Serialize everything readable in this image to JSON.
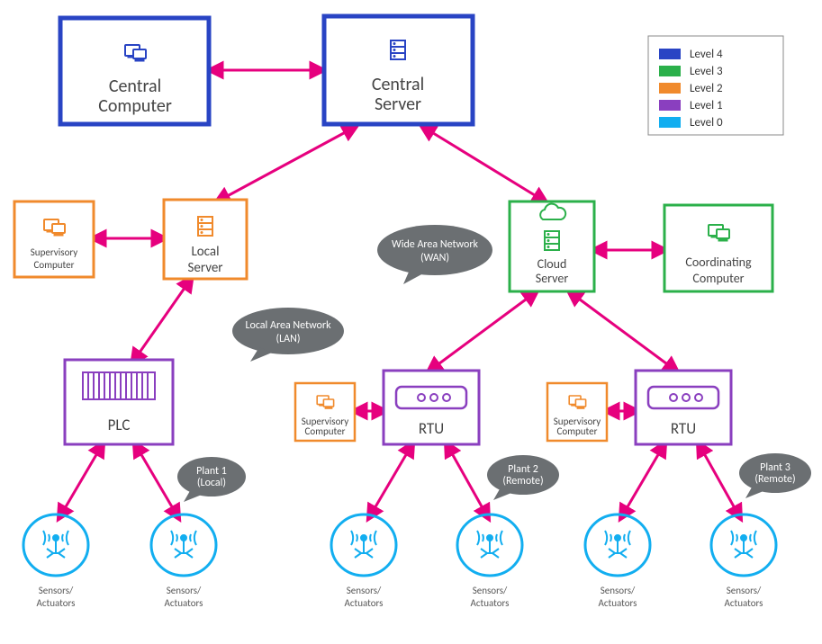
{
  "colors": {
    "level4": "#2944c4",
    "level3": "#2bb04a",
    "level2": "#f08a2c",
    "level1": "#8a3fbf",
    "level0": "#12aef0",
    "arrow": "#e6007e",
    "bubble": "#6b6f72"
  },
  "legend": {
    "items": [
      {
        "label": "Level 4",
        "colorKey": "level4"
      },
      {
        "label": "Level 3",
        "colorKey": "level3"
      },
      {
        "label": "Level 2",
        "colorKey": "level2"
      },
      {
        "label": "Level 1",
        "colorKey": "level1"
      },
      {
        "label": "Level 0",
        "colorKey": "level0"
      }
    ]
  },
  "nodes": {
    "centralComputer": {
      "label": "Central Computer",
      "level": 4
    },
    "centralServer": {
      "label": "Central Server",
      "level": 4
    },
    "supComp1": {
      "label": "Supervisory Computer",
      "level": 2
    },
    "localServer": {
      "label": "Local Server",
      "level": 2
    },
    "cloudServer": {
      "label": "Cloud Server",
      "level": 3
    },
    "coordComputer": {
      "label": "Coordinating Computer",
      "level": 3
    },
    "plc": {
      "label": "PLC",
      "level": 1
    },
    "supComp2": {
      "label": "Supervisory Computer",
      "level": 2
    },
    "rtu1": {
      "label": "RTU",
      "level": 1
    },
    "supComp3": {
      "label": "Supervisory Computer",
      "level": 2
    },
    "rtu2": {
      "label": "RTU",
      "level": 1
    },
    "sensor1": {
      "label": "Sensors/ Actuators",
      "level": 0
    },
    "sensor2": {
      "label": "Sensors/ Actuators",
      "level": 0
    },
    "sensor3": {
      "label": "Sensors/ Actuators",
      "level": 0
    },
    "sensor4": {
      "label": "Sensors/ Actuators",
      "level": 0
    },
    "sensor5": {
      "label": "Sensors/ Actuators",
      "level": 0
    },
    "sensor6": {
      "label": "Sensors/ Actuators",
      "level": 0
    }
  },
  "bubbles": {
    "wan": {
      "line1": "Wide Area Network",
      "line2": "(WAN)"
    },
    "lan": {
      "line1": "Local Area Network",
      "line2": "(LAN)"
    },
    "plant1": {
      "line1": "Plant 1",
      "line2": "(Local)"
    },
    "plant2": {
      "line1": "Plant 2",
      "line2": "(Remote)"
    },
    "plant3": {
      "line1": "Plant 3",
      "line2": "(Remote)"
    }
  },
  "sensorLabel": {
    "line1": "Sensors/",
    "line2": "Actuators"
  }
}
